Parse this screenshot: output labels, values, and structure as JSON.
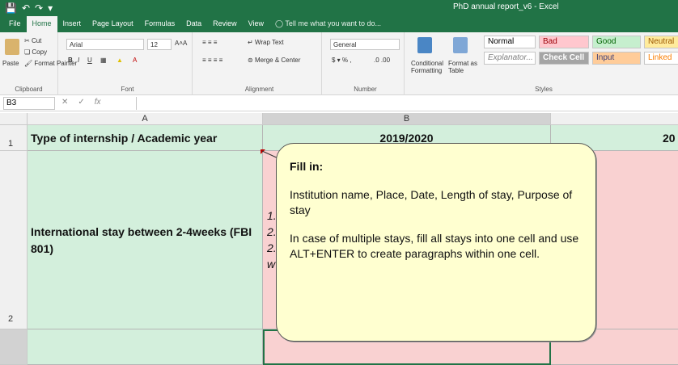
{
  "window": {
    "title": "PhD annual report_v6 - Excel"
  },
  "ribbon_tabs": [
    "File",
    "Home",
    "Insert",
    "Page Layout",
    "Formulas",
    "Data",
    "Review",
    "View"
  ],
  "tell_me": "Tell me what you want to do...",
  "clipboard": {
    "paste": "Paste",
    "cut": "Cut",
    "copy": "Copy",
    "format_painter": "Format Painter",
    "label": "Clipboard"
  },
  "font": {
    "name": "Arial",
    "size": "12",
    "label": "Font"
  },
  "alignment": {
    "wrap_text": "Wrap Text",
    "merge_center": "Merge & Center",
    "label": "Alignment"
  },
  "number": {
    "format": "General",
    "label": "Number"
  },
  "styles": {
    "conditional": "Conditional Formatting",
    "format_as_table": "Format as Table",
    "label": "Styles",
    "cells": [
      {
        "name": "Normal",
        "bg": "#ffffff",
        "fg": "#000000"
      },
      {
        "name": "Bad",
        "bg": "#ffc7ce",
        "fg": "#9c0006"
      },
      {
        "name": "Good",
        "bg": "#c6efce",
        "fg": "#006100"
      },
      {
        "name": "Neutral",
        "bg": "#ffeb9c",
        "fg": "#9c5700"
      },
      {
        "name": "Explanator...",
        "bg": "#ffffff",
        "fg": "#7f7f7f"
      },
      {
        "name": "Check Cell",
        "bg": "#a5a5a5",
        "fg": "#ffffff"
      },
      {
        "name": "Input",
        "bg": "#ffcc99",
        "fg": "#3f3f76"
      },
      {
        "name": "Linked",
        "bg": "#ffffff",
        "fg": "#fa7d00"
      }
    ]
  },
  "formula_bar": {
    "name_box": "B3",
    "fx": "fx",
    "value": ""
  },
  "sheet": {
    "columns": [
      "A",
      "B"
    ],
    "rows": [
      "1",
      "2"
    ],
    "a1": "Type of internship / Academic year",
    "b1": "2019/2020",
    "c1": "20",
    "a2": "International stay between 2-4weeks (FBI 801)",
    "b2_fragments": [
      "1.",
      "2.",
      "2.",
      "w"
    ]
  },
  "comment": {
    "title": "Fill in:",
    "para1": "Institution name, Place, Date, Length of stay, Purpose of stay",
    "para2": "In case of multiple stays, fill all stays into one cell and use ALT+ENTER to create paragraphs within one cell."
  },
  "colors": {
    "excel_green": "#217346",
    "cell_green": "#d3efdc",
    "cell_pink": "#f9d1d1",
    "comment_bg": "#ffffd0"
  }
}
